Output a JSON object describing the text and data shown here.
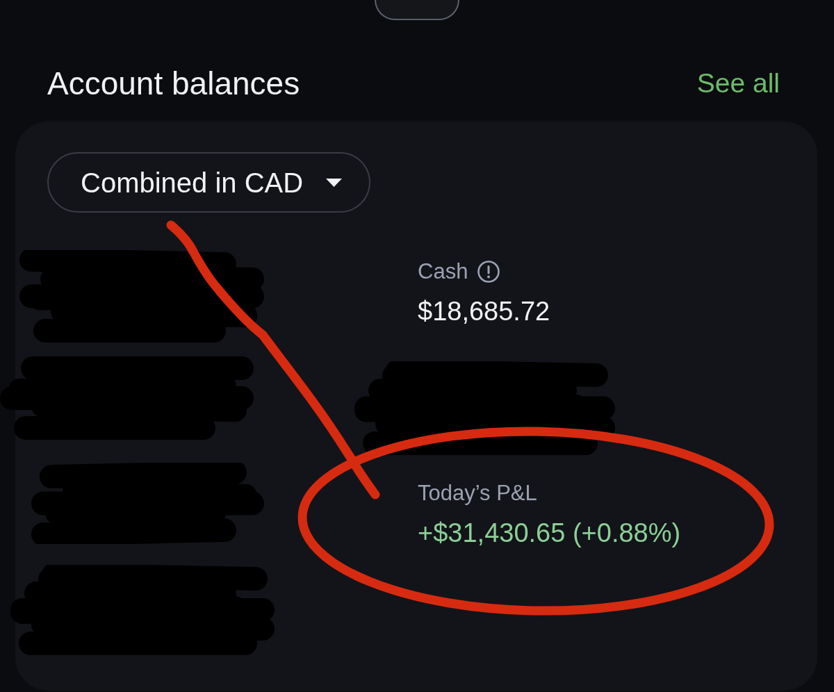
{
  "header": {
    "title": "Account balances",
    "link": "See all"
  },
  "card": {
    "dropdown": {
      "value": "Combined in CAD"
    },
    "left_items": [
      {
        "kind": "redacted"
      },
      {
        "kind": "redacted"
      },
      {
        "kind": "redacted"
      },
      {
        "kind": "redacted"
      }
    ],
    "right_items": [
      {
        "kind": "metric",
        "label": "Cash",
        "info_icon": true,
        "value": "$18,685.72",
        "gain": false
      },
      {
        "kind": "redacted"
      },
      {
        "kind": "metric",
        "label": "Today’s P&L",
        "value": "+$31,430.65 (+0.88%)",
        "gain": true
      }
    ]
  }
}
